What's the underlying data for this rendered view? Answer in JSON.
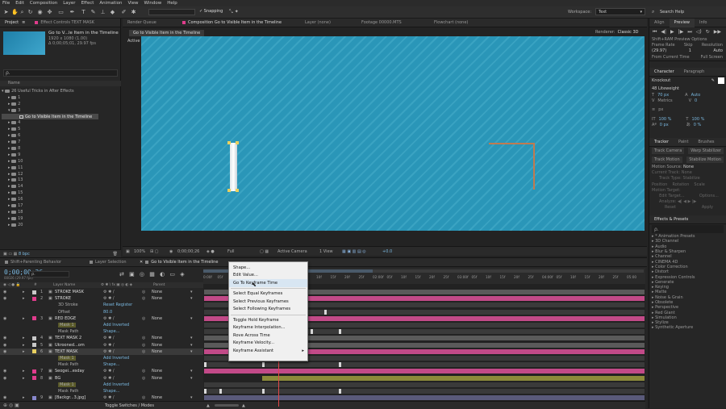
{
  "menubar": {
    "items": [
      "File",
      "Edit",
      "Composition",
      "Layer",
      "Effect",
      "Animation",
      "View",
      "Window",
      "Help"
    ]
  },
  "toolbar": {
    "snapping": "Snapping",
    "workspace_label": "Workspace:",
    "workspace_value": "Text",
    "search_help": "Search Help"
  },
  "project": {
    "tabs": [
      "Project",
      "Effect Controls TEXT MASK"
    ],
    "comp_name": "Go to V...le Item in the Timeline",
    "comp_info1": "1920 x 1080 (1.00)",
    "comp_info2": "Δ 0;00;05;01, 29.97 fps",
    "search_placeholder": "ρ.",
    "col_name": "Name",
    "root": "26 Useful Tricks in After Effects",
    "folders": [
      "1",
      "2",
      "3",
      "4",
      "5",
      "6",
      "7",
      "8",
      "9",
      "10",
      "11",
      "12",
      "13",
      "14",
      "15",
      "16",
      "17",
      "18",
      "19",
      "20"
    ],
    "selected_item": "Go to Visible Item in the Timeline",
    "footer_bpc": "8 bpc"
  },
  "comp": {
    "tabs": [
      "Render Queue",
      "Composition Go to Visible Item in the Timeline",
      "Layer (none)",
      "Footage 00000.MTS",
      "Flowchart (none)"
    ],
    "comp_tab_label": "Go to Visible Item in the Timeline",
    "renderer_label": "Renderer:",
    "renderer_value": "Classic 3D",
    "active_camera": "Active Camera",
    "bottom": {
      "zoom": "100%",
      "time": "0;00;00;26",
      "resolution": "Full",
      "camera": "Active Camera",
      "view": "1 View",
      "exposure": "+0.0"
    }
  },
  "right": {
    "tabs1": [
      "Align",
      "Preview",
      "Info"
    ],
    "preview_label": "Shift+RAM Preview Options",
    "frame_rate_label": "Frame Rate",
    "skip_label": "Skip",
    "resolution_label": "Resolution",
    "frame_rate_value": "(29.97)",
    "skip_value": "1",
    "resolution_value": "Auto",
    "from_current": "From Current Time",
    "full_screen": "Full Screen",
    "tabs2": [
      "Character",
      "Paragraph"
    ],
    "font": "Knockout",
    "weight": "48 Liteweight",
    "font_size": "70 px",
    "leading": "Auto",
    "kerning": "Metrics",
    "tracking": "0",
    "stroke_width": "px",
    "vscale": "100 %",
    "hscale": "100 %",
    "baseline": "0 px",
    "tsume": "0 %",
    "tabs3": [
      "Tracker",
      "Paint",
      "Brushes"
    ],
    "track_camera": "Track Camera",
    "warp_stab": "Warp Stabilizer",
    "track_motion": "Track Motion",
    "stabilize_motion": "Stabilize Motion",
    "motion_source_label": "Motion Source:",
    "motion_source_value": "None",
    "current_track_label": "Current Track:",
    "current_track_value": "None",
    "track_type_label": "Track Type:",
    "track_type_value": "Stabilize",
    "position": "Position",
    "rotation": "Rotation",
    "scale": "Scale",
    "motion_target": "Motion Target:",
    "edit_target": "Edit Target...",
    "options": "Options...",
    "analyze": "Analyze:",
    "reset": "Reset",
    "apply": "Apply",
    "effects_tab": "Effects & Presets",
    "effects_search": "ρ.",
    "effects": [
      "* Animation Presets",
      "3D Channel",
      "Audio",
      "Blur & Sharpen",
      "Channel",
      "CINEMA 4D",
      "Color Correction",
      "Distort",
      "Expression Controls",
      "Generate",
      "Keying",
      "Matte",
      "Noise & Grain",
      "Obsolete",
      "Perspective",
      "Red Giant",
      "Simulation",
      "Stylize",
      "Synthetic Aperture"
    ]
  },
  "timeline": {
    "tabs": [
      "Shift+Parenting Behavior",
      "Layer Selection",
      "Go to Visible Item in the Timeline"
    ],
    "timecode": "0;00;00;26",
    "timecode_sub": "00026 (29.97 fps)",
    "col_layer_name": "Layer Name",
    "col_parent": "Parent",
    "toggle": "Toggle Switches / Modes",
    "ruler": [
      "0:00f",
      "05f",
      "10f",
      "15f",
      "20f",
      "25f",
      "01:00f",
      "05f",
      "10f",
      "15f",
      "20f",
      "25f",
      "02:00f",
      "05f",
      "10f",
      "15f",
      "20f",
      "25f",
      "03:00f",
      "05f",
      "10f",
      "15f",
      "20f",
      "25f",
      "04:00f",
      "05f",
      "10f",
      "15f",
      "20f",
      "25f",
      "05:00"
    ],
    "layers": [
      {
        "num": "1",
        "name": "STROKE MASK",
        "color": "#c8c8c8",
        "parent": "None",
        "kind": "layer"
      },
      {
        "num": "2",
        "name": "STROKE",
        "color": "#e03c8c",
        "parent": "None",
        "kind": "layer"
      },
      {
        "num": "",
        "name": "3D Stroke",
        "color": "",
        "parent": "Reset  Register",
        "kind": "prop"
      },
      {
        "num": "",
        "name": "Offset",
        "color": "",
        "parent": "80.0",
        "kind": "prop"
      },
      {
        "num": "3",
        "name": "RED EDGE",
        "color": "#e03c8c",
        "parent": "None",
        "kind": "layer"
      },
      {
        "num": "",
        "name": "Mask 1",
        "color": "#e8d060",
        "parent": "Add  Inverted",
        "kind": "prop"
      },
      {
        "num": "",
        "name": "Mask Path",
        "color": "",
        "parent": "Shape...",
        "kind": "prop"
      },
      {
        "num": "4",
        "name": "TEXT MASK 2",
        "color": "#c8c8c8",
        "parent": "None",
        "kind": "layer"
      },
      {
        "num": "5",
        "name": "Ukrooned...om",
        "color": "#c8c8c8",
        "parent": "None",
        "kind": "layer"
      },
      {
        "num": "6",
        "name": "TEXT MASK",
        "color": "#e8d060",
        "parent": "None",
        "kind": "layer"
      },
      {
        "num": "",
        "name": "Mask 1",
        "color": "#e8d060",
        "parent": "Add  Inverted",
        "kind": "prop"
      },
      {
        "num": "",
        "name": "Mask Path",
        "color": "",
        "parent": "Shape...",
        "kind": "prop"
      },
      {
        "num": "7",
        "name": "Seogei...esday",
        "color": "#e03c8c",
        "parent": "None",
        "kind": "layer"
      },
      {
        "num": "8",
        "name": "BG",
        "color": "#e03c8c",
        "parent": "None",
        "kind": "layer"
      },
      {
        "num": "",
        "name": "Mask 1",
        "color": "#e8d060",
        "parent": "Add  Inverted",
        "kind": "prop"
      },
      {
        "num": "",
        "name": "Mask Path",
        "color": "",
        "parent": "Shape...",
        "kind": "prop"
      },
      {
        "num": "9",
        "name": "[Backgr...3.jpg]",
        "color": "#8888cc",
        "parent": "None",
        "kind": "layer"
      }
    ]
  },
  "context_menu": {
    "items": [
      "Shape...",
      "Edit Value...",
      "Go To Keyframe Time",
      "Select Equal Keyframes",
      "Select Previous Keyframes",
      "Select Following Keyframes",
      "Toggle Hold Keyframe",
      "Keyframe Interpolation...",
      "Rove Across Time",
      "Keyframe Velocity...",
      "Keyframe Assistant"
    ],
    "highlighted": "Go To Keyframe Time"
  },
  "colors": {
    "canvas": "#2a96b8",
    "pink": "#e03c8c",
    "olive": "#8c8a3a",
    "accent": "#e8d060",
    "playhead": "#e04848"
  }
}
